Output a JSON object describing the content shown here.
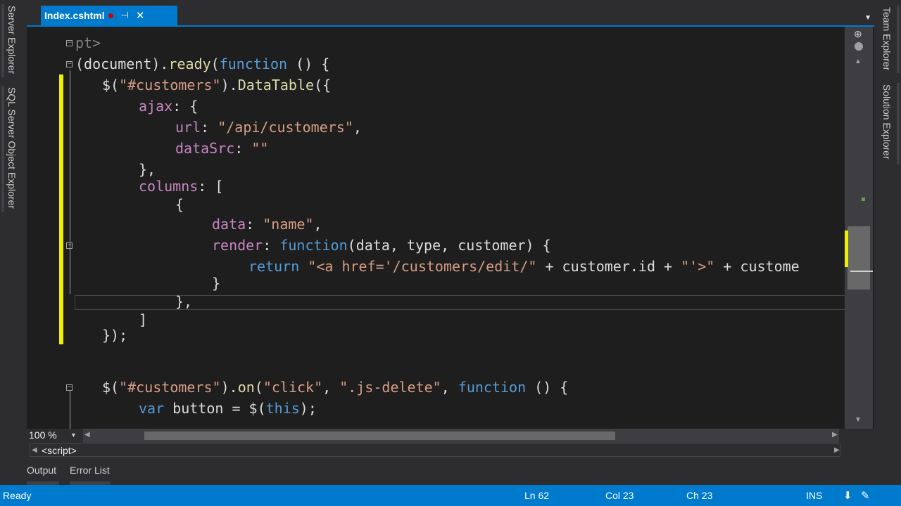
{
  "left_side_tabs": [
    "Server Explorer",
    "SQL Server Object Explorer"
  ],
  "right_side_tabs": [
    "Team Explorer",
    "Solution Explorer"
  ],
  "document_tab": {
    "title": "Index.cshtml",
    "pin_icon": "⊣",
    "close_icon": "✕"
  },
  "tab_dropdown_icon": "▼",
  "code_lines": [
    {
      "tokens": [
        {
          "t": "pt>",
          "c": "tag"
        }
      ]
    },
    {
      "tokens": [
        {
          "t": "(document).",
          "c": "plain"
        },
        {
          "t": "ready",
          "c": "func"
        },
        {
          "t": "(",
          "c": "plain"
        },
        {
          "t": "function",
          "c": "key"
        },
        {
          "t": " () {",
          "c": "plain"
        }
      ]
    },
    {
      "tokens": [
        {
          "t": "$(",
          "c": "plain"
        },
        {
          "t": "\"#customers\"",
          "c": "str"
        },
        {
          "t": ").",
          "c": "plain"
        },
        {
          "t": "DataTable",
          "c": "func"
        },
        {
          "t": "({",
          "c": "plain"
        }
      ]
    },
    {
      "tokens": [
        {
          "t": "ajax",
          "c": "prop"
        },
        {
          "t": ": {",
          "c": "plain"
        }
      ]
    },
    {
      "tokens": [
        {
          "t": "url",
          "c": "prop"
        },
        {
          "t": ": ",
          "c": "plain"
        },
        {
          "t": "\"/api/customers\"",
          "c": "str"
        },
        {
          "t": ",",
          "c": "plain"
        }
      ]
    },
    {
      "tokens": [
        {
          "t": "dataSrc",
          "c": "prop"
        },
        {
          "t": ": ",
          "c": "plain"
        },
        {
          "t": "\"\"",
          "c": "str"
        }
      ]
    },
    {
      "tokens": [
        {
          "t": "},",
          "c": "plain"
        }
      ]
    },
    {
      "tokens": [
        {
          "t": "columns",
          "c": "prop"
        },
        {
          "t": ": [",
          "c": "plain"
        }
      ]
    },
    {
      "tokens": [
        {
          "t": "{",
          "c": "plain"
        }
      ]
    },
    {
      "tokens": [
        {
          "t": "data",
          "c": "prop"
        },
        {
          "t": ": ",
          "c": "plain"
        },
        {
          "t": "\"name\"",
          "c": "str"
        },
        {
          "t": ",",
          "c": "plain"
        }
      ]
    },
    {
      "tokens": [
        {
          "t": "render",
          "c": "prop"
        },
        {
          "t": ": ",
          "c": "plain"
        },
        {
          "t": "function",
          "c": "key"
        },
        {
          "t": "(data, type, customer) {",
          "c": "plain"
        }
      ]
    },
    {
      "tokens": [
        {
          "t": "return",
          "c": "key"
        },
        {
          "t": " ",
          "c": "plain"
        },
        {
          "t": "\"<a href='/customers/edit/\"",
          "c": "str"
        },
        {
          "t": " + customer.id + ",
          "c": "plain"
        },
        {
          "t": "\"'>\"",
          "c": "str"
        },
        {
          "t": " + custome",
          "c": "plain"
        }
      ]
    },
    {
      "tokens": [
        {
          "t": "}",
          "c": "plain"
        }
      ]
    },
    {
      "tokens": [
        {
          "t": "},",
          "c": "plain"
        }
      ]
    },
    {
      "tokens": [
        {
          "t": "]",
          "c": "plain"
        }
      ]
    },
    {
      "tokens": [
        {
          "t": "});",
          "c": "plain"
        }
      ]
    },
    {
      "tokens": [
        {
          "t": "$(",
          "c": "plain"
        },
        {
          "t": "\"#customers\"",
          "c": "str"
        },
        {
          "t": ").",
          "c": "plain"
        },
        {
          "t": "on",
          "c": "func"
        },
        {
          "t": "(",
          "c": "plain"
        },
        {
          "t": "\"click\"",
          "c": "str"
        },
        {
          "t": ", ",
          "c": "plain"
        },
        {
          "t": "\".js-delete\"",
          "c": "str"
        },
        {
          "t": ", ",
          "c": "plain"
        },
        {
          "t": "function",
          "c": "key"
        },
        {
          "t": " () {",
          "c": "plain"
        }
      ]
    },
    {
      "tokens": [
        {
          "t": "var",
          "c": "key"
        },
        {
          "t": " button = $(",
          "c": "plain"
        },
        {
          "t": "this",
          "c": "key"
        },
        {
          "t": ");",
          "c": "plain"
        }
      ]
    }
  ],
  "outline_toggle_glyph": "−",
  "zoom": {
    "value": "100 %",
    "dropdown_icon": "▼"
  },
  "scroll_icons": {
    "up": "▲",
    "down": "▼",
    "left": "◀",
    "right": "▶",
    "split": "⊕"
  },
  "nav_bar": {
    "scope": "<script>"
  },
  "tool_tabs": [
    "Output",
    "Error List"
  ],
  "status": {
    "ready": "Ready",
    "line": "Ln 62",
    "col": "Col 23",
    "ch": "Ch 23",
    "mode": "INS",
    "publish_icon": "⬇",
    "feedback_icon": "✎"
  },
  "colors": {
    "accent": "#007acc",
    "editor_bg": "#1e1e1e",
    "chrome_bg": "#2d2d30",
    "change_bar": "#efef00"
  }
}
